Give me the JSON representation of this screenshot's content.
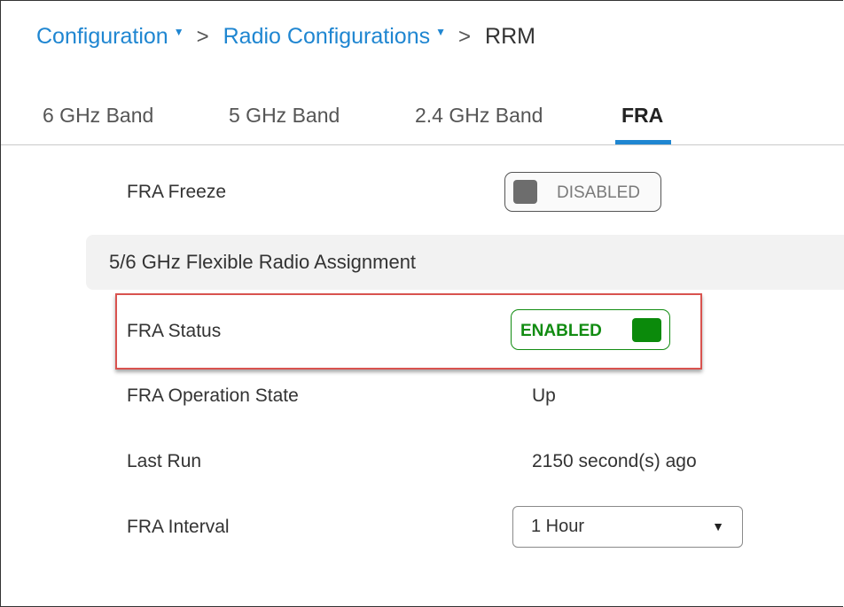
{
  "breadcrumb": {
    "items": [
      "Configuration",
      "Radio Configurations"
    ],
    "separator": ">",
    "current": "RRM"
  },
  "tabs": [
    {
      "label": "6 GHz Band",
      "active": false
    },
    {
      "label": "5 GHz Band",
      "active": false
    },
    {
      "label": "2.4 GHz Band",
      "active": false
    },
    {
      "label": "FRA",
      "active": true
    }
  ],
  "fra_freeze": {
    "label": "FRA Freeze",
    "toggle_text": "DISABLED",
    "enabled": false
  },
  "section": {
    "title": "5/6 GHz Flexible Radio Assignment"
  },
  "fra_status": {
    "label": "FRA Status",
    "toggle_text": "ENABLED",
    "enabled": true
  },
  "operation_state": {
    "label": "FRA Operation State",
    "value": "Up"
  },
  "last_run": {
    "label": "Last Run",
    "value": "2150 second(s) ago"
  },
  "fra_interval": {
    "label": "FRA Interval",
    "selected": "1 Hour"
  },
  "colors": {
    "link": "#1f86d1",
    "enabled_green": "#128c12",
    "disabled_gray": "#6d6d6d",
    "highlight_red": "#d9534f"
  }
}
